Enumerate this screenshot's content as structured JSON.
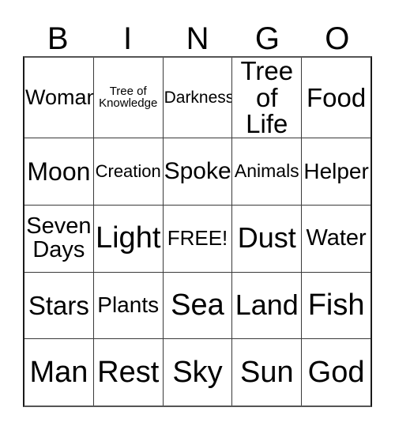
{
  "card": {
    "headers": [
      "B",
      "I",
      "N",
      "G",
      "O"
    ],
    "rows": [
      [
        {
          "text": "Woman",
          "font_size": 27
        },
        {
          "text": "Tree of\nKnowledge",
          "font_size": 15
        },
        {
          "text": "Darkness",
          "font_size": 21
        },
        {
          "text": "Tree\nof Life",
          "font_size": 33
        },
        {
          "text": "Food",
          "font_size": 33
        }
      ],
      [
        {
          "text": "Moon",
          "font_size": 32
        },
        {
          "text": "Creation",
          "font_size": 22
        },
        {
          "text": "Spoke",
          "font_size": 30
        },
        {
          "text": "Animals",
          "font_size": 23
        },
        {
          "text": "Helper",
          "font_size": 28
        }
      ],
      [
        {
          "text": "Seven\nDays",
          "font_size": 29
        },
        {
          "text": "Light",
          "font_size": 38
        },
        {
          "text": "FREE!",
          "font_size": 26
        },
        {
          "text": "Dust",
          "font_size": 36
        },
        {
          "text": "Water",
          "font_size": 29
        }
      ],
      [
        {
          "text": "Stars",
          "font_size": 33
        },
        {
          "text": "Plants",
          "font_size": 28
        },
        {
          "text": "Sea",
          "font_size": 38
        },
        {
          "text": "Land",
          "font_size": 36
        },
        {
          "text": "Fish",
          "font_size": 38
        }
      ],
      [
        {
          "text": "Man",
          "font_size": 38
        },
        {
          "text": "Rest",
          "font_size": 38
        },
        {
          "text": "Sky",
          "font_size": 38
        },
        {
          "text": "Sun",
          "font_size": 38
        },
        {
          "text": "God",
          "font_size": 38
        }
      ]
    ],
    "free_space": {
      "row": 2,
      "column": 2,
      "label": "FREE!"
    },
    "colors": {
      "background": "#ffffff",
      "text": "#000000",
      "grid_line": "#3a3a3a",
      "outer_border": "#1a1a1a"
    }
  }
}
